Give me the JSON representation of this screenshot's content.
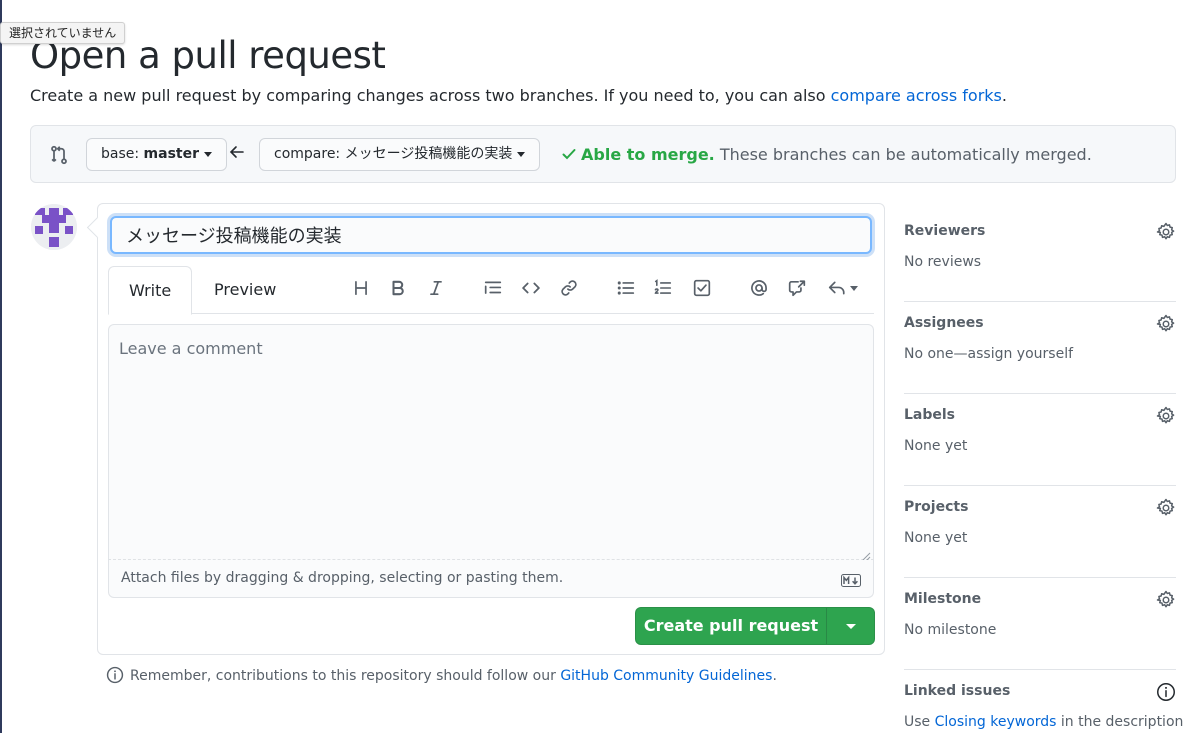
{
  "tooltip": "選択されていません",
  "page": {
    "title": "Open a pull request",
    "subtitle_before": "Create a new pull request by comparing changes across two branches. If you need to, you can also ",
    "subtitle_link": "compare across forks",
    "subtitle_after": "."
  },
  "range": {
    "base_prefix": "base: ",
    "base_branch": "master",
    "compare_prefix": "compare: ",
    "compare_branch": "メッセージ投稿機能の実装",
    "merge_status": "Able to merge.",
    "merge_detail": " These branches can be automatically merged."
  },
  "form": {
    "title_value": "メッセージ投稿機能の実装",
    "tabs": [
      "Write",
      "Preview"
    ],
    "comment_placeholder": "Leave a comment",
    "attach_text": "Attach files by dragging & dropping, selecting or pasting them.",
    "submit_label": "Create pull request"
  },
  "toolbar_icons": [
    "heading-icon",
    "bold-icon",
    "italic-icon",
    "quote-icon",
    "code-icon",
    "link-icon",
    "unordered-list-icon",
    "ordered-list-icon",
    "task-list-icon",
    "mention-icon",
    "cross-reference-icon",
    "reply-icon"
  ],
  "footer": {
    "remember_before": "Remember, contributions to this repository should follow our ",
    "remember_link": "GitHub Community Guidelines",
    "remember_after": "."
  },
  "sidebar": {
    "sections": [
      {
        "title": "Reviewers",
        "value": "No reviews"
      },
      {
        "title": "Assignees",
        "value": "No one—assign yourself"
      },
      {
        "title": "Labels",
        "value": "None yet"
      },
      {
        "title": "Projects",
        "value": "None yet"
      },
      {
        "title": "Milestone",
        "value": "No milestone"
      }
    ],
    "linked": {
      "title": "Linked issues",
      "value_before": "Use ",
      "value_link": "Closing keywords",
      "value_after": " in the description"
    }
  },
  "colors": {
    "accent_link": "#0366d6",
    "merge_ok": "#28a745",
    "primary_button": "#2ea44f",
    "focus_border": "#79b8ff"
  }
}
